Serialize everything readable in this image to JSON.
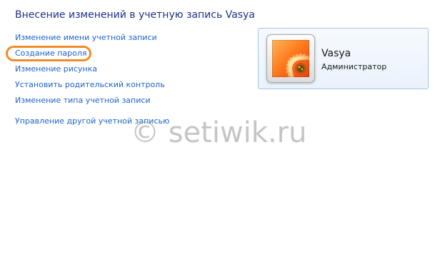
{
  "page": {
    "title": "Внесение изменений в учетную запись Vasya"
  },
  "tasks": [
    {
      "label": "Изменение имени учетной записи"
    },
    {
      "label": "Создание пароля"
    },
    {
      "label": "Изменение рисунка"
    },
    {
      "label": "Установить родительский контроль"
    },
    {
      "label": "Изменение типа учетной записи"
    },
    {
      "label": "Управление другой учетной записью"
    }
  ],
  "account": {
    "name": "Vasya",
    "role": "Администратор",
    "picture_icon": "orange-flower-picture"
  },
  "watermark": {
    "text": "© setiwik.ru"
  },
  "colors": {
    "title": "#1e3287",
    "link": "#1e64c8",
    "highlight": "#f28c28"
  }
}
